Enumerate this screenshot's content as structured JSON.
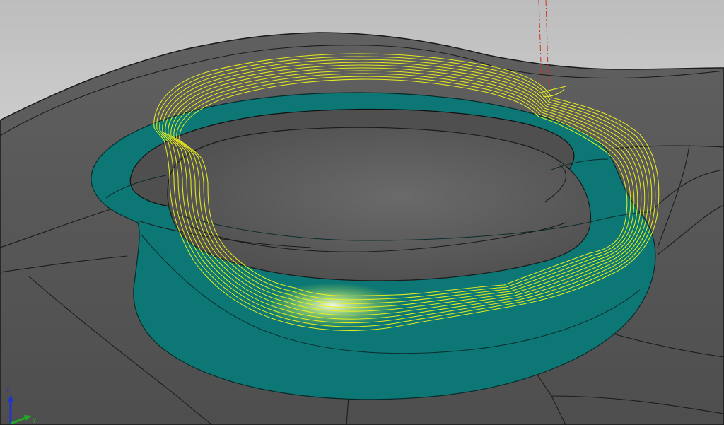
{
  "viewport": {
    "background_top": "#bfbfbf",
    "background_bottom": "#efefef",
    "surface_color": "#565656",
    "surface_edge_color": "#1a1a1a",
    "pocket_wall_color": "#0c7774",
    "toolpath_color": "#ecf21a",
    "tool_axis_color": "#cc3322"
  },
  "triad": {
    "z_label": "z",
    "y_label": "y",
    "z_color": "#2233cc",
    "y_color": "#22aa22"
  }
}
